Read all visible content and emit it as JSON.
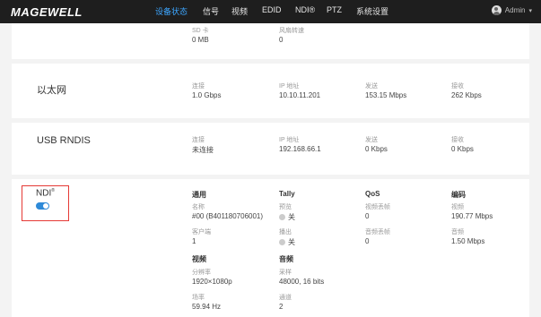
{
  "header": {
    "logo": "MAGEWELL",
    "nav": [
      "设备状态",
      "信号",
      "视频",
      "EDID",
      "NDI®",
      "PTZ",
      "系统设置"
    ],
    "user": "Admin"
  },
  "storage": {
    "sd_label": "SD 卡",
    "sd_value": "0 MB",
    "fan_label": "风扇转速",
    "fan_value": "0"
  },
  "ethernet": {
    "title": "以太网",
    "link_label": "连接",
    "link_value": "1.0 Gbps",
    "ip_label": "IP 地址",
    "ip_value": "10.10.11.201",
    "tx_label": "发送",
    "tx_value": "153.15 Mbps",
    "rx_label": "接收",
    "rx_value": "262 Kbps"
  },
  "usb": {
    "title": "USB RNDIS",
    "link_label": "连接",
    "link_value": "未连接",
    "ip_label": "IP 地址",
    "ip_value": "192.168.66.1",
    "tx_label": "发送",
    "tx_value": "0 Kbps",
    "rx_label": "接收",
    "rx_value": "0 Kbps"
  },
  "ndi": {
    "title": "NDI",
    "reg": "®",
    "enabled": true,
    "general": {
      "header": "通用",
      "name_label": "名称",
      "name_value": "#00 (B401180706001)",
      "clients_label": "客户端",
      "clients_value": "1"
    },
    "tally": {
      "header": "Tally",
      "preview_label": "预览",
      "preview_value": "关",
      "program_label": "播出",
      "program_value": "关"
    },
    "qos": {
      "header": "QoS",
      "video_drop_label": "视频丢帧",
      "video_drop_value": "0",
      "audio_drop_label": "音频丢帧",
      "audio_drop_value": "0"
    },
    "encoding": {
      "header": "编码",
      "video_label": "视频",
      "video_value": "190.77 Mbps",
      "audio_label": "音频",
      "audio_value": "1.50 Mbps"
    },
    "video": {
      "header": "视频",
      "resolution_label": "分辨率",
      "resolution_value": "1920×1080p",
      "framerate_label": "场率",
      "framerate_value": "59.94 Hz"
    },
    "audio": {
      "header": "音频",
      "sample_label": "采样",
      "sample_value": "48000, 16 bits",
      "channels_label": "通道",
      "channels_value": "2"
    }
  }
}
